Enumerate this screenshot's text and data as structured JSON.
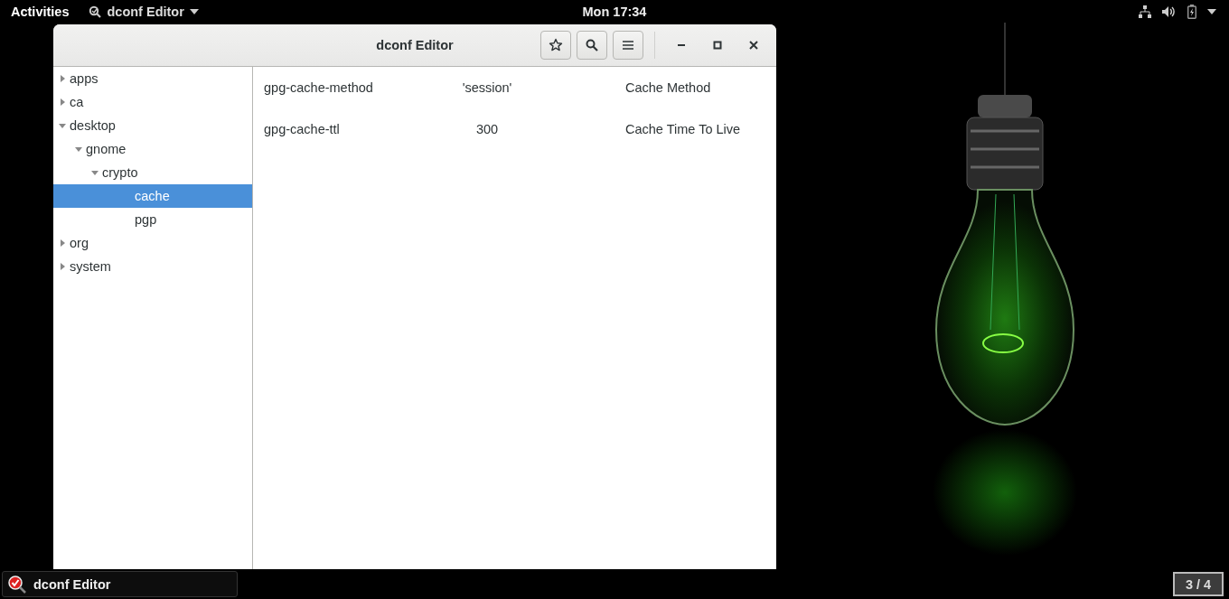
{
  "top_bar": {
    "activities": "Activities",
    "app_menu": "dconf Editor",
    "clock": "Mon 17:34"
  },
  "window": {
    "title": "dconf Editor"
  },
  "tree": [
    {
      "label": "apps",
      "kind": "folder",
      "expanded": false,
      "selected": false
    },
    {
      "label": "ca",
      "kind": "folder",
      "expanded": false,
      "selected": false
    },
    {
      "label": "desktop",
      "kind": "folder",
      "expanded": true,
      "selected": false,
      "children": [
        {
          "label": "gnome",
          "kind": "folder",
          "expanded": true,
          "selected": false,
          "children": [
            {
              "label": "crypto",
              "kind": "folder",
              "expanded": true,
              "selected": false,
              "children": [
                {
                  "label": "cache",
                  "kind": "leaf",
                  "selected": true
                },
                {
                  "label": "pgp",
                  "kind": "leaf",
                  "selected": false
                }
              ]
            }
          ]
        }
      ]
    },
    {
      "label": "org",
      "kind": "folder",
      "expanded": false,
      "selected": false
    },
    {
      "label": "system",
      "kind": "folder",
      "expanded": false,
      "selected": false
    }
  ],
  "keys": [
    {
      "name": "gpg-cache-method",
      "value": "'session'",
      "summary": "Cache Method"
    },
    {
      "name": "gpg-cache-ttl",
      "value": "300",
      "summary": "Cache Time To Live"
    }
  ],
  "taskbar": {
    "window_button": "dconf Editor",
    "workspace": "3 / 4"
  }
}
